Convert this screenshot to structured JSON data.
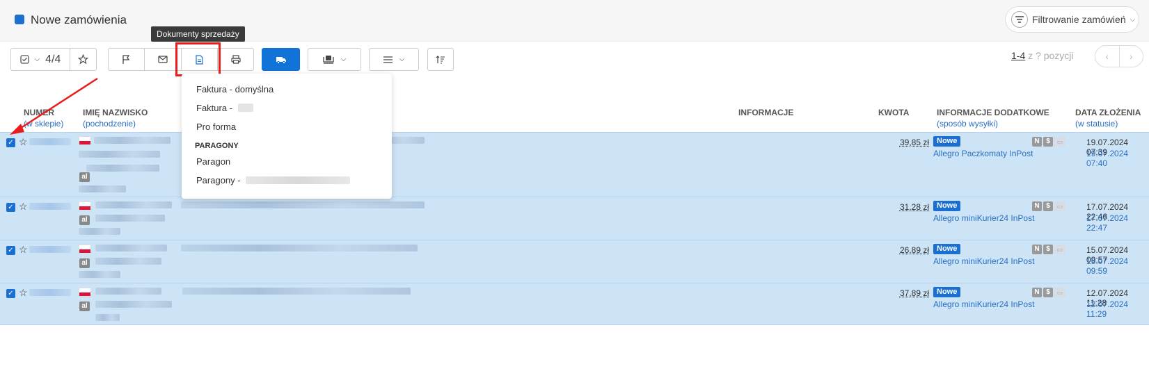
{
  "header": {
    "title": "Nowe zamówienia",
    "filter_label": "Filtrowanie zamówień"
  },
  "tooltip": "Dokumenty sprzedaży",
  "toolbar": {
    "select_count": "4/4",
    "pagination_current": "1-4",
    "pagination_rest": " z ? pozycji"
  },
  "columns": {
    "number": "NUMER",
    "number_sub": "(w sklepie)",
    "name": "IMIĘ NAZWISKO",
    "name_sub": "(pochodzenie)",
    "info": "INFORMACJE",
    "amount": "KWOTA",
    "extra": "INFORMACJE DODATKOWE",
    "extra_sub": "(sposób wysyłki)",
    "date": "DATA ZŁOŻENIA",
    "date_sub": "(w statusie)"
  },
  "dropdown": {
    "items": [
      "Faktura - domyślna",
      "Faktura -",
      "Pro forma"
    ],
    "section": "PARAGONY",
    "section_items": [
      "Paragon",
      "Paragony -"
    ]
  },
  "rows": [
    {
      "amount": "39,85 zł",
      "status": "Nowe",
      "shipping": "Allegro Paczkomaty InPost",
      "date_created": "19.07.2024 07:39",
      "date_status": "19.07.2024 07:40",
      "origin_badge": "al"
    },
    {
      "amount": "31,28 zł",
      "status": "Nowe",
      "shipping": "Allegro miniKurier24 InPost",
      "date_created": "17.07.2024 22:46",
      "date_status": "17.07.2024 22:47",
      "origin_badge": "al"
    },
    {
      "amount": "26,89 zł",
      "status": "Nowe",
      "shipping": "Allegro miniKurier24 InPost",
      "date_created": "15.07.2024 09:57",
      "date_status": "15.07.2024 09:59",
      "origin_badge": "al"
    },
    {
      "amount": "37,89 zł",
      "status": "Nowe",
      "shipping": "Allegro miniKurier24 InPost",
      "date_created": "12.07.2024 11:28",
      "date_status": "12.07.2024 11:29",
      "origin_badge": "al"
    }
  ],
  "row_icons": {
    "n": "N",
    "s": "$"
  },
  "colors": {
    "accent": "#1a6fd0",
    "row_selected": "#cde3f6",
    "highlight": "#e81c1c"
  }
}
